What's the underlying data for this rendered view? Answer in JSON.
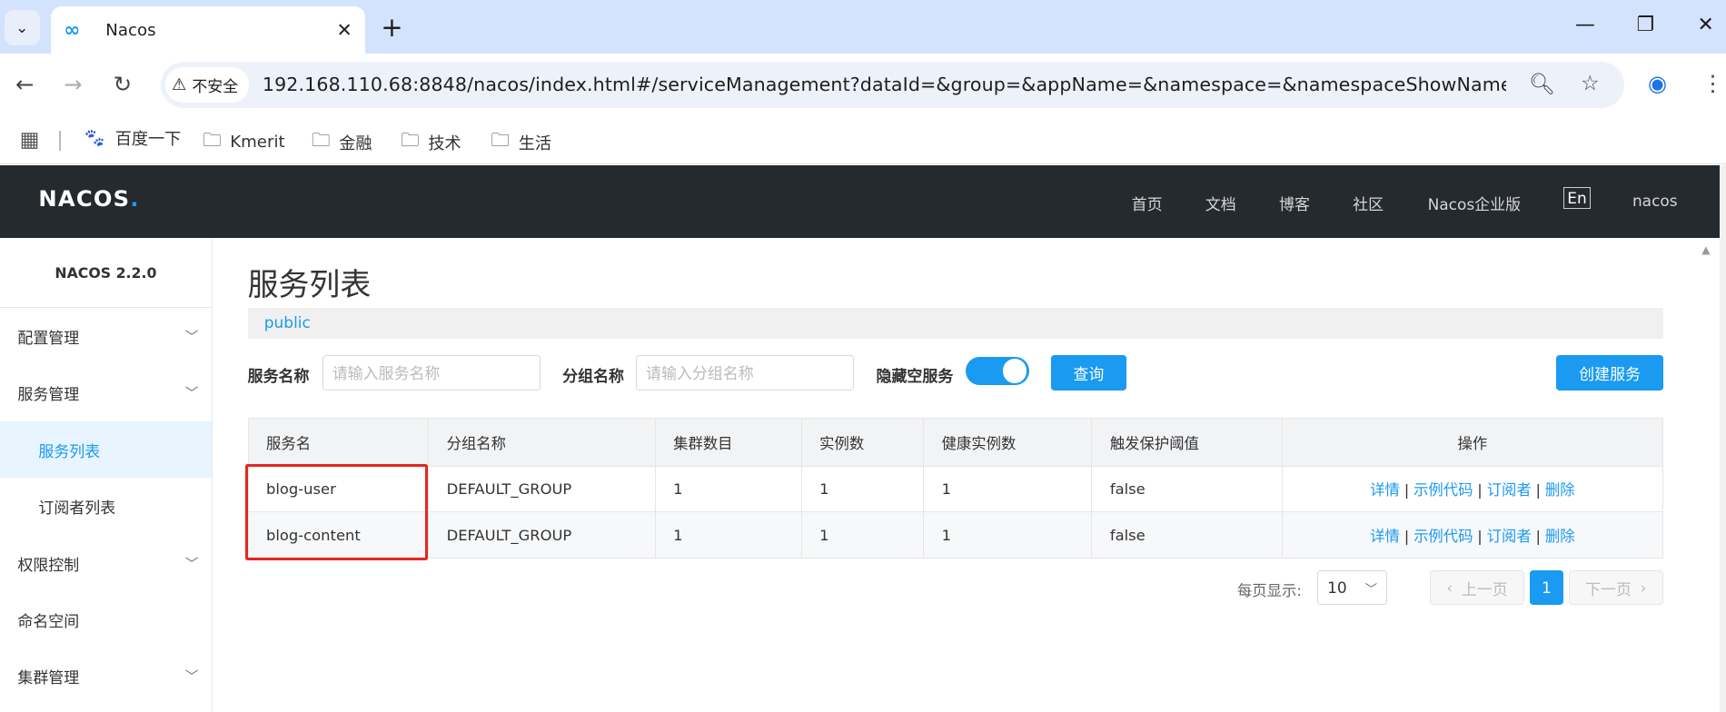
{
  "browser": {
    "tab_title": "Nacos",
    "security_label": "不安全",
    "url": "192.168.110.68:8848/nacos/index.html#/serviceManagement?dataId=&group=&appName=&namespace=&namespaceShowName=p...",
    "bookmarks": [
      "百度一下",
      "Kmerit",
      "金融",
      "技术",
      "生活"
    ]
  },
  "header": {
    "logo": "NACOS",
    "logo_dot": ".",
    "nav": [
      "首页",
      "文档",
      "博客",
      "社区",
      "Nacos企业版"
    ],
    "lang": "En",
    "user": "nacos"
  },
  "sidebar": {
    "version": "NACOS 2.2.0",
    "items": [
      {
        "label": "配置管理",
        "expandable": true
      },
      {
        "label": "服务管理",
        "expandable": true
      },
      {
        "label": "服务列表",
        "active": true
      },
      {
        "label": "订阅者列表"
      },
      {
        "label": "权限控制",
        "expandable": true
      },
      {
        "label": "命名空间"
      },
      {
        "label": "集群管理",
        "expandable": true
      }
    ]
  },
  "main": {
    "title": "服务列表",
    "namespace": "public",
    "filters": {
      "service_name_label": "服务名称",
      "service_name_placeholder": "请输入服务名称",
      "group_name_label": "分组名称",
      "group_name_placeholder": "请输入分组名称",
      "hide_empty_label": "隐藏空服务",
      "hide_empty_on": true,
      "query_button": "查询",
      "create_button": "创建服务"
    },
    "table": {
      "columns": [
        "服务名",
        "分组名称",
        "集群数目",
        "实例数",
        "健康实例数",
        "触发保护阈值",
        "操作"
      ],
      "rows": [
        [
          "blog-user",
          "DEFAULT_GROUP",
          "1",
          "1",
          "1",
          "false"
        ],
        [
          "blog-content",
          "DEFAULT_GROUP",
          "1",
          "1",
          "1",
          "false"
        ]
      ],
      "ops": [
        "详情",
        "示例代码",
        "订阅者",
        "删除"
      ]
    },
    "pagination": {
      "page_size_label": "每页显示:",
      "page_size": "10",
      "prev": "上一页",
      "current": "1",
      "next": "下一页"
    }
  },
  "colors": {
    "accent": "#1a9af0",
    "header_bg": "#252a2f",
    "highlight": "#e5261f"
  }
}
